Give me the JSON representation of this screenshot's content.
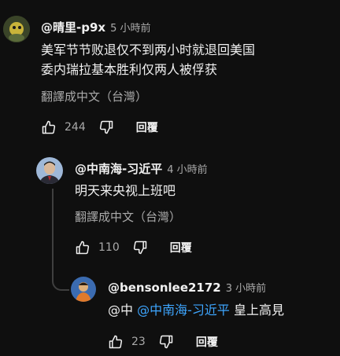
{
  "comments": [
    {
      "author": "@晴里-p9x",
      "time": "5 小時前",
      "lines": [
        "美军节节败退仅不到两小时就退回美国",
        "委内瑞拉基本胜利仅两人被俘获"
      ],
      "translate": "翻譯成中文（台灣）",
      "likes": "244",
      "reply": "回覆"
    },
    {
      "author": "@中南海-习近平",
      "time": "4 小時前",
      "lines": [
        "明天来央视上班吧"
      ],
      "translate": "翻譯成中文（台灣）",
      "likes": "110",
      "reply": "回覆"
    },
    {
      "author": "@bensonlee2172",
      "time": "3 小時前",
      "prefix": "@中",
      "mention": "@中南海-习近平",
      "suffix": "皇上高見",
      "likes": "23",
      "reply": "回覆"
    }
  ],
  "colors": {
    "mention": "#3ea6ff",
    "background": "#0f0f0f"
  }
}
